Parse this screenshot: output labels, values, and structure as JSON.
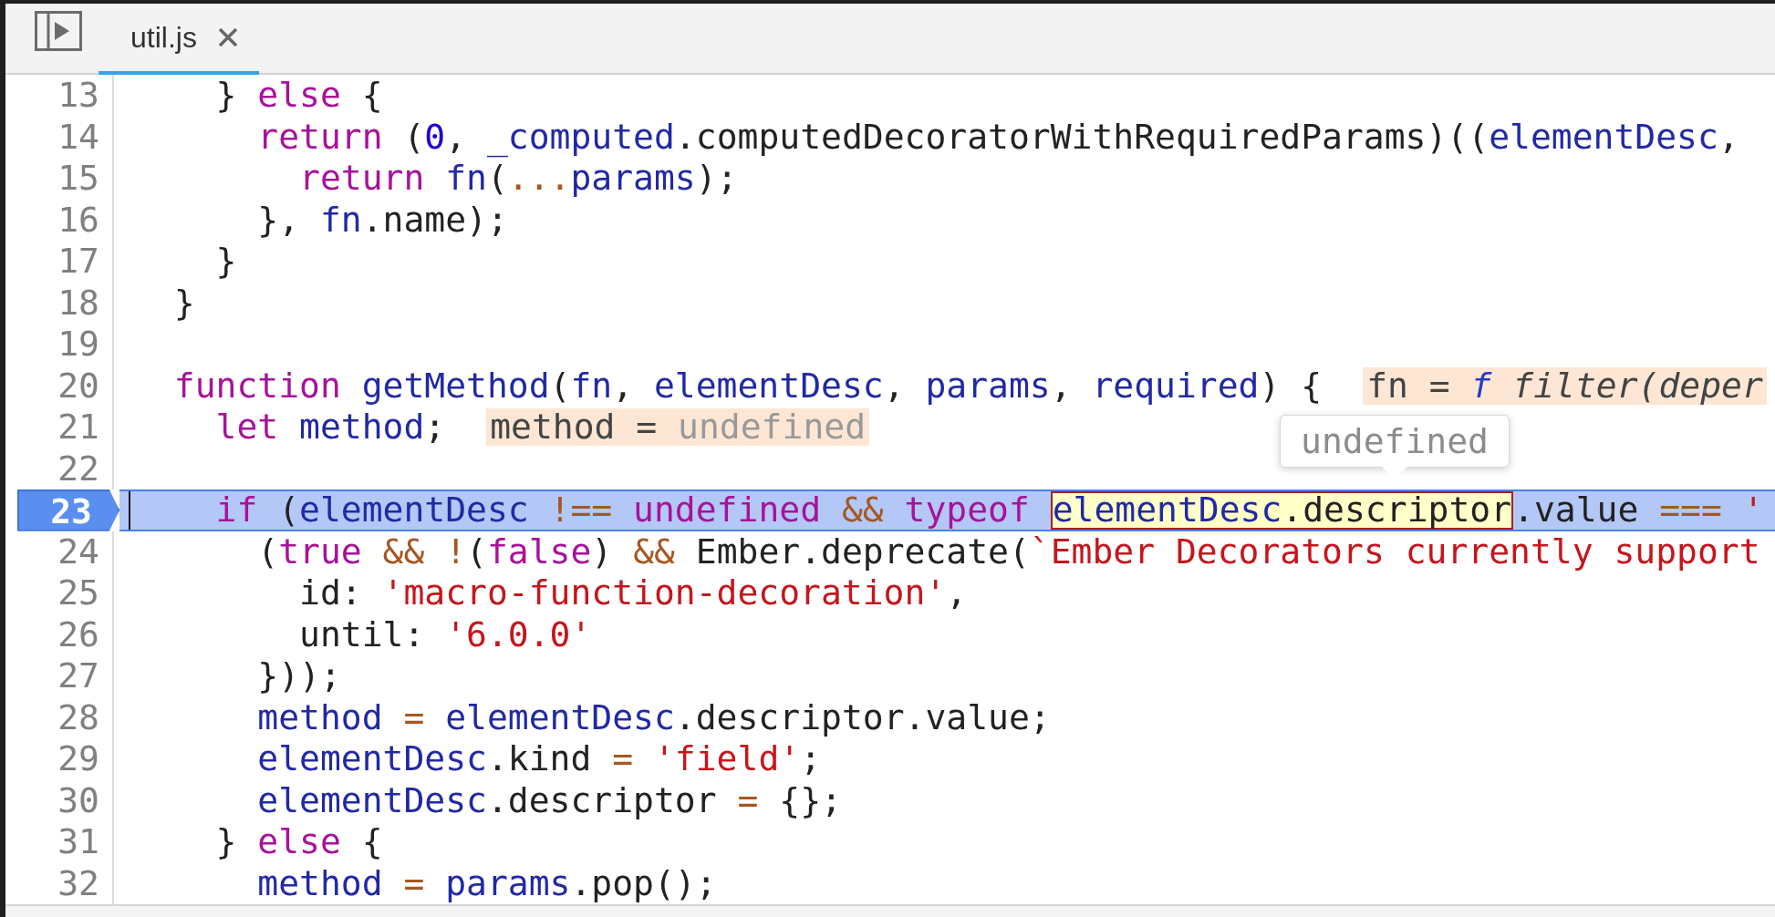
{
  "tabs": [
    {
      "label": "util.js",
      "selected": true
    }
  ],
  "lines": [
    {
      "number": "13",
      "breakpoint": false,
      "current": false,
      "tokens": [
        {
          "text": "    } ",
          "kind": "plain"
        },
        {
          "text": "else",
          "kind": "kw"
        },
        {
          "text": " {",
          "kind": "plain"
        }
      ]
    },
    {
      "number": "14",
      "breakpoint": false,
      "current": false,
      "tokens": [
        {
          "text": "      return",
          "kind": "kw"
        },
        {
          "text": " (",
          "kind": "plain"
        },
        {
          "text": "0",
          "kind": "num"
        },
        {
          "text": ", ",
          "kind": "plain"
        },
        {
          "text": "_computed",
          "kind": "var"
        },
        {
          "text": ".computedDecoratorWithRequiredParams)((",
          "kind": "plain"
        },
        {
          "text": "elementDesc",
          "kind": "var"
        },
        {
          "text": ",",
          "kind": "plain"
        }
      ]
    },
    {
      "number": "15",
      "breakpoint": false,
      "current": false,
      "tokens": [
        {
          "text": "        return",
          "kind": "kw"
        },
        {
          "text": " fn",
          "kind": "var"
        },
        {
          "text": "(",
          "kind": "plain"
        },
        {
          "text": "...",
          "kind": "op"
        },
        {
          "text": "params",
          "kind": "var"
        },
        {
          "text": ");",
          "kind": "plain"
        }
      ]
    },
    {
      "number": "16",
      "breakpoint": false,
      "current": false,
      "tokens": [
        {
          "text": "      }, ",
          "kind": "plain"
        },
        {
          "text": "fn",
          "kind": "var"
        },
        {
          "text": ".name);",
          "kind": "plain"
        }
      ]
    },
    {
      "number": "17",
      "breakpoint": false,
      "current": false,
      "tokens": [
        {
          "text": "    }",
          "kind": "plain"
        }
      ]
    },
    {
      "number": "18",
      "breakpoint": false,
      "current": false,
      "tokens": [
        {
          "text": "  }",
          "kind": "plain"
        }
      ]
    },
    {
      "number": "19",
      "breakpoint": false,
      "current": false
    },
    {
      "number": "20",
      "breakpoint": false,
      "current": false,
      "tokens": [
        {
          "text": "  function",
          "kind": "kw"
        },
        {
          "text": " getMethod",
          "kind": "var"
        },
        {
          "text": "(",
          "kind": "plain"
        },
        {
          "text": "fn",
          "kind": "var"
        },
        {
          "text": ", ",
          "kind": "plain"
        },
        {
          "text": "elementDesc",
          "kind": "var"
        },
        {
          "text": ", ",
          "kind": "plain"
        },
        {
          "text": "params",
          "kind": "var"
        },
        {
          "text": ", ",
          "kind": "plain"
        },
        {
          "text": "required",
          "kind": "var"
        },
        {
          "text": ") {",
          "kind": "plain"
        }
      ],
      "inline_value": [
        {
          "text": "fn = ",
          "kind": "name"
        },
        {
          "text": "f",
          "kind": "fn-mark"
        },
        {
          "text": " filter(deper",
          "kind": "fn-text"
        }
      ]
    },
    {
      "number": "21",
      "breakpoint": false,
      "current": false,
      "tokens": [
        {
          "text": "    let",
          "kind": "kw"
        },
        {
          "text": " method",
          "kind": "var"
        },
        {
          "text": ";",
          "kind": "plain"
        }
      ],
      "inline_value": [
        {
          "text": "method = ",
          "kind": "name"
        },
        {
          "text": "undefined",
          "kind": "undef"
        }
      ]
    },
    {
      "number": "22",
      "breakpoint": false,
      "current": false
    },
    {
      "number": "23",
      "breakpoint": true,
      "current": true,
      "tokens": [
        {
          "text": "    if",
          "kind": "kw"
        },
        {
          "text": " (",
          "kind": "plain"
        },
        {
          "text": "elementDesc",
          "kind": "var"
        },
        {
          "text": " !==",
          "kind": "op"
        },
        {
          "text": " undefined",
          "kind": "kw"
        },
        {
          "text": " &&",
          "kind": "op"
        },
        {
          "text": " typeof ",
          "kind": "kw"
        }
      ],
      "hovered": {
        "tokens": [
          {
            "text": "elementDesc",
            "kind": "var"
          },
          {
            "text": ".descriptor",
            "kind": "plain"
          }
        ],
        "popover": "undefined"
      },
      "tokens_after": [
        {
          "text": ".value ",
          "kind": "plain"
        },
        {
          "text": "===",
          "kind": "op"
        },
        {
          "text": " '",
          "kind": "str"
        }
      ]
    },
    {
      "number": "24",
      "breakpoint": false,
      "current": false,
      "tokens": [
        {
          "text": "      (",
          "kind": "plain"
        },
        {
          "text": "true",
          "kind": "kw"
        },
        {
          "text": " &&",
          "kind": "op"
        },
        {
          "text": " !",
          "kind": "op"
        },
        {
          "text": "(",
          "kind": "plain"
        },
        {
          "text": "false",
          "kind": "kw"
        },
        {
          "text": ") ",
          "kind": "plain"
        },
        {
          "text": "&&",
          "kind": "op"
        },
        {
          "text": " Ember.deprecate(",
          "kind": "plain"
        },
        {
          "text": "`Ember Decorators currently support",
          "kind": "str"
        }
      ]
    },
    {
      "number": "25",
      "breakpoint": false,
      "current": false,
      "tokens": [
        {
          "text": "        id: ",
          "kind": "plain"
        },
        {
          "text": "'macro-function-decoration'",
          "kind": "str"
        },
        {
          "text": ",",
          "kind": "plain"
        }
      ]
    },
    {
      "number": "26",
      "breakpoint": false,
      "current": false,
      "tokens": [
        {
          "text": "        until: ",
          "kind": "plain"
        },
        {
          "text": "'6.0.0'",
          "kind": "str"
        }
      ]
    },
    {
      "number": "27",
      "breakpoint": false,
      "current": false,
      "tokens": [
        {
          "text": "      }));",
          "kind": "plain"
        }
      ]
    },
    {
      "number": "28",
      "breakpoint": false,
      "current": false,
      "tokens": [
        {
          "text": "      method",
          "kind": "var"
        },
        {
          "text": " =",
          "kind": "op"
        },
        {
          "text": " elementDesc",
          "kind": "var"
        },
        {
          "text": ".descriptor.value;",
          "kind": "plain"
        }
      ]
    },
    {
      "number": "29",
      "breakpoint": false,
      "current": false,
      "tokens": [
        {
          "text": "      elementDesc",
          "kind": "var"
        },
        {
          "text": ".kind ",
          "kind": "plain"
        },
        {
          "text": "=",
          "kind": "op"
        },
        {
          "text": " 'field'",
          "kind": "str"
        },
        {
          "text": ";",
          "kind": "plain"
        }
      ]
    },
    {
      "number": "30",
      "breakpoint": false,
      "current": false,
      "tokens": [
        {
          "text": "      elementDesc",
          "kind": "var"
        },
        {
          "text": ".descriptor ",
          "kind": "plain"
        },
        {
          "text": "=",
          "kind": "op"
        },
        {
          "text": " {};",
          "kind": "plain"
        }
      ]
    },
    {
      "number": "31",
      "breakpoint": false,
      "current": false,
      "tokens": [
        {
          "text": "    } ",
          "kind": "plain"
        },
        {
          "text": "else",
          "kind": "kw"
        },
        {
          "text": " {",
          "kind": "plain"
        }
      ]
    },
    {
      "number": "32",
      "breakpoint": false,
      "current": false,
      "tokens": [
        {
          "text": "      method",
          "kind": "var"
        },
        {
          "text": " =",
          "kind": "op"
        },
        {
          "text": " params",
          "kind": "var"
        },
        {
          "text": ".pop();",
          "kind": "plain"
        }
      ]
    }
  ]
}
